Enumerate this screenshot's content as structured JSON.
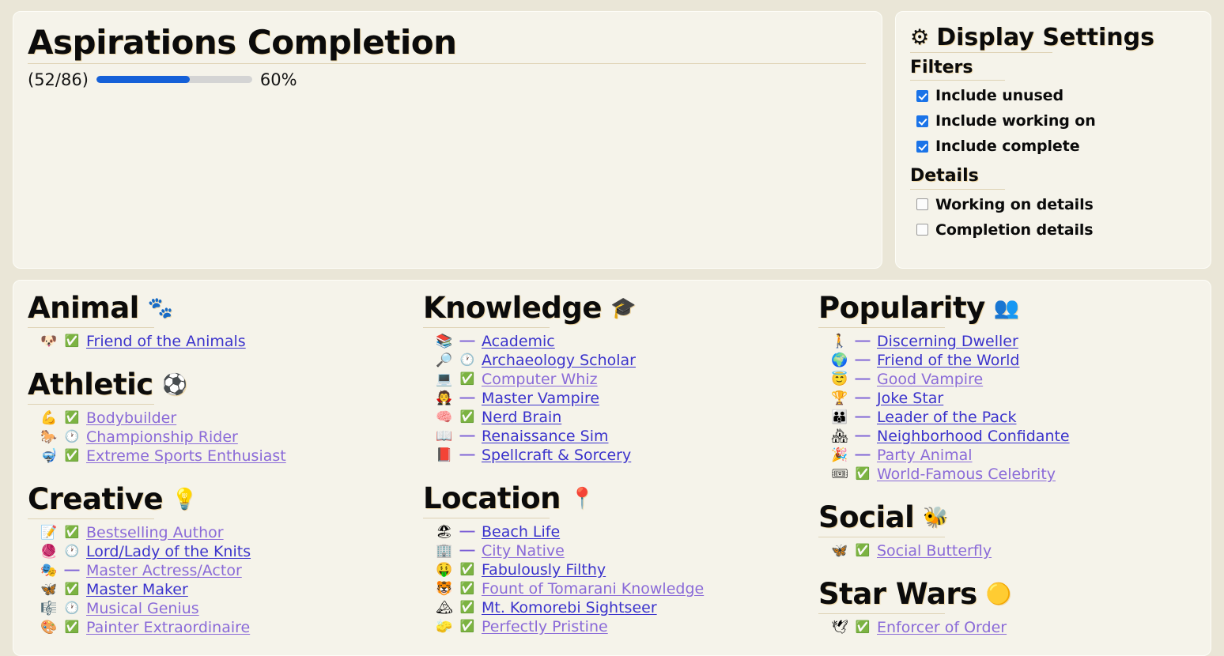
{
  "progress": {
    "title": "Aspirations Completion",
    "fraction": "(52/86)",
    "percent_label": "60%",
    "percent_value": 60,
    "bar_color": "#1560d8",
    "track_color": "#d4d4d4"
  },
  "settings": {
    "title": "Display Settings",
    "gear_icon": "⚙",
    "filters_heading": "Filters",
    "details_heading": "Details",
    "filters": [
      {
        "label": "Include unused",
        "checked": true
      },
      {
        "label": "Include working on",
        "checked": true
      },
      {
        "label": "Include complete",
        "checked": true
      }
    ],
    "details": [
      {
        "label": "Working on details",
        "checked": false
      },
      {
        "label": "Completion details",
        "checked": false
      }
    ],
    "accent": "#1a73e8"
  },
  "status_glyphs": {
    "complete": "✅",
    "working": "🕐",
    "unused": "—"
  },
  "columns": [
    {
      "categories": [
        {
          "name": "Animal",
          "emoji": "🐾",
          "items": [
            {
              "emoji": "🐶",
              "status": "complete",
              "label": "Friend of the Animals",
              "visited": false
            }
          ]
        },
        {
          "name": "Athletic",
          "emoji": "⚽",
          "items": [
            {
              "emoji": "💪",
              "status": "complete",
              "label": "Bodybuilder",
              "visited": true
            },
            {
              "emoji": "🐎",
              "status": "working",
              "label": "Championship Rider",
              "visited": true
            },
            {
              "emoji": "🤿",
              "status": "complete",
              "label": "Extreme Sports Enthusiast",
              "visited": true
            }
          ]
        },
        {
          "name": "Creative",
          "emoji": "💡",
          "items": [
            {
              "emoji": "📝",
              "status": "complete",
              "label": "Bestselling Author",
              "visited": true
            },
            {
              "emoji": "🧶",
              "status": "working",
              "label": "Lord/Lady of the Knits",
              "visited": false
            },
            {
              "emoji": "🎭",
              "status": "unused",
              "label": "Master Actress/Actor",
              "visited": true
            },
            {
              "emoji": "🦋",
              "status": "complete",
              "label": "Master Maker",
              "visited": false
            },
            {
              "emoji": "🎼",
              "status": "working",
              "label": "Musical Genius",
              "visited": true
            },
            {
              "emoji": "🎨",
              "status": "complete",
              "label": "Painter Extraordinaire",
              "visited": true
            }
          ]
        }
      ]
    },
    {
      "categories": [
        {
          "name": "Knowledge",
          "emoji": "🎓",
          "items": [
            {
              "emoji": "📚",
              "status": "unused",
              "label": "Academic",
              "visited": false
            },
            {
              "emoji": "🔎",
              "status": "working",
              "label": "Archaeology Scholar",
              "visited": false
            },
            {
              "emoji": "💻",
              "status": "complete",
              "label": "Computer Whiz",
              "visited": true
            },
            {
              "emoji": "🧛",
              "status": "unused",
              "label": "Master Vampire",
              "visited": false
            },
            {
              "emoji": "🧠",
              "status": "complete",
              "label": "Nerd Brain",
              "visited": false
            },
            {
              "emoji": "📖",
              "status": "unused",
              "label": "Renaissance Sim",
              "visited": false
            },
            {
              "emoji": "📕",
              "status": "unused",
              "label": "Spellcraft & Sorcery",
              "visited": false
            }
          ]
        },
        {
          "name": "Location",
          "emoji": "📍",
          "items": [
            {
              "emoji": "🏖",
              "status": "unused",
              "label": "Beach Life",
              "visited": false
            },
            {
              "emoji": "🏢",
              "status": "unused",
              "label": "City Native",
              "visited": true
            },
            {
              "emoji": "🤑",
              "status": "complete",
              "label": "Fabulously Filthy",
              "visited": false
            },
            {
              "emoji": "🐯",
              "status": "complete",
              "label": "Fount of Tomarani Knowledge",
              "visited": true
            },
            {
              "emoji": "🏔",
              "status": "complete",
              "label": "Mt. Komorebi Sightseer",
              "visited": false
            },
            {
              "emoji": "🧽",
              "status": "complete",
              "label": "Perfectly Pristine",
              "visited": true
            }
          ]
        }
      ]
    },
    {
      "categories": [
        {
          "name": "Popularity",
          "emoji": "👥",
          "items": [
            {
              "emoji": "🚶",
              "status": "unused",
              "label": "Discerning Dweller",
              "visited": false
            },
            {
              "emoji": "🌍",
              "status": "unused",
              "label": "Friend of the World",
              "visited": false
            },
            {
              "emoji": "😇",
              "status": "unused",
              "label": "Good Vampire",
              "visited": true
            },
            {
              "emoji": "🏆",
              "status": "unused",
              "label": "Joke Star",
              "visited": false
            },
            {
              "emoji": "👪",
              "status": "unused",
              "label": "Leader of the Pack",
              "visited": false
            },
            {
              "emoji": "🏘",
              "status": "unused",
              "label": "Neighborhood Confidante",
              "visited": false
            },
            {
              "emoji": "🎉",
              "status": "unused",
              "label": "Party Animal",
              "visited": true
            },
            {
              "emoji": "🎟",
              "status": "complete",
              "label": "World-Famous Celebrity",
              "visited": true
            }
          ]
        },
        {
          "name": "Social",
          "emoji": "🐝",
          "items": [
            {
              "emoji": "🦋",
              "status": "complete",
              "label": "Social Butterfly",
              "visited": true
            }
          ]
        },
        {
          "name": "Star Wars",
          "emoji": "🟡",
          "items": [
            {
              "emoji": "🕊",
              "status": "complete",
              "label": "Enforcer of Order",
              "visited": true
            }
          ]
        }
      ]
    }
  ]
}
